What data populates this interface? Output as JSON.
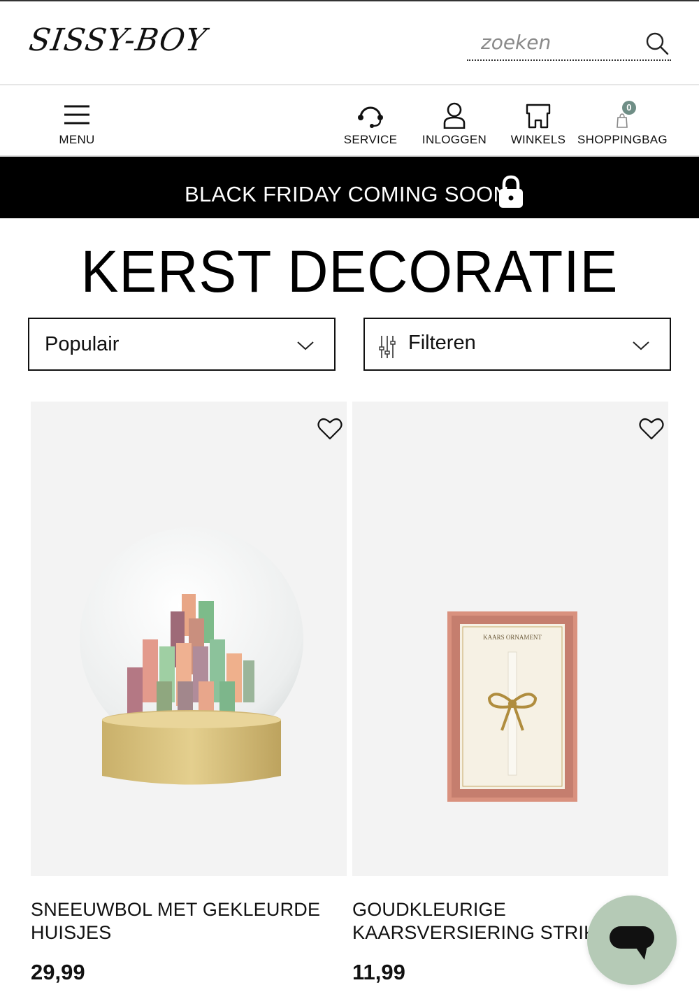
{
  "header": {
    "logo": "SISSY-BOY",
    "search": {
      "placeholder": "zoeken"
    }
  },
  "nav": {
    "menu": "MENU",
    "service": "SERVICE",
    "login": "INLOGGEN",
    "stores": "WINKELS",
    "bag": "SHOPPINGBAG",
    "bag_count": "0"
  },
  "promo": {
    "text": "BLACK FRIDAY COMING SOON"
  },
  "page": {
    "title": "KERST DECORATIE"
  },
  "controls": {
    "sort_selected": "Populair",
    "filter_label": "Filteren"
  },
  "products": [
    {
      "name": "SNEEUWBOL MET GEKLEURDE HUISJES",
      "price": "29,99"
    },
    {
      "name": "GOUDKLEURIGE KAARSVERSIERING STRIK",
      "price": "11,99"
    }
  ],
  "product_box_text": "KAARS ORNAMENT",
  "colors": {
    "accent_badge": "#6f8e86",
    "chat_button": "#b5cab6",
    "promo_bg": "#000000"
  },
  "icons": [
    "search-icon",
    "hamburger-icon",
    "headset-icon",
    "user-icon",
    "store-icon",
    "bag-icon",
    "lock-icon",
    "chevron-down-icon",
    "sliders-icon",
    "heart-icon",
    "chat-icon"
  ]
}
